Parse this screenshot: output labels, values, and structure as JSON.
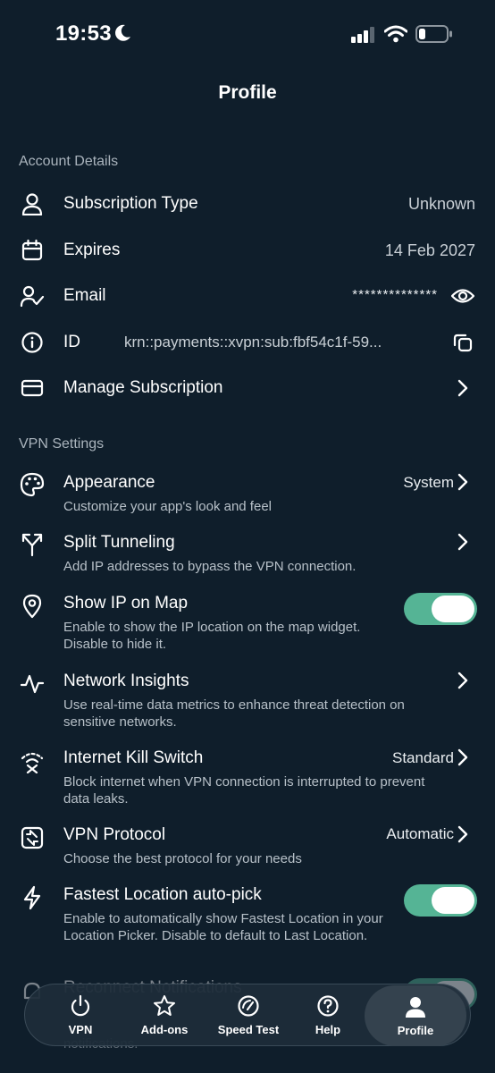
{
  "status": {
    "time": "19:53"
  },
  "header": {
    "title": "Profile"
  },
  "account": {
    "heading": "Account Details",
    "subscription_label": "Subscription Type",
    "subscription_value": "Unknown",
    "expires_label": "Expires",
    "expires_value": "14 Feb 2027",
    "email_label": "Email",
    "email_value": "**************",
    "id_label": "ID",
    "id_value": "krn::payments::xvpn:sub:fbf54c1f-59...",
    "manage_label": "Manage Subscription"
  },
  "vpn": {
    "heading": "VPN Settings",
    "appearance": {
      "title": "Appearance",
      "sub": "Customize your app's look and feel",
      "value": "System"
    },
    "split": {
      "title": "Split Tunneling",
      "sub": "Add IP addresses to bypass the VPN connection."
    },
    "showip": {
      "title": "Show IP on Map",
      "sub": "Enable to show the IP location on the map widget. Disable to hide it.",
      "enabled": true
    },
    "insights": {
      "title": "Network Insights",
      "sub": "Use real-time data metrics to enhance threat detection on sensitive networks."
    },
    "killswitch": {
      "title": "Internet Kill Switch",
      "sub": "Block internet when VPN connection is interrupted to prevent data leaks.",
      "value": "Standard"
    },
    "protocol": {
      "title": "VPN Protocol",
      "sub": "Choose the best protocol for your needs",
      "value": "Automatic"
    },
    "fastest": {
      "title": "Fastest Location auto-pick",
      "sub": "Enable to automatically show Fastest Location in your Location Picker. Disable to default to Last Location.",
      "enabled": true
    },
    "reconnect": {
      "title": "Reconnect Notifications",
      "sub": "notifications."
    }
  },
  "nav": {
    "vpn": "VPN",
    "addons": "Add-ons",
    "speed": "Speed Test",
    "help": "Help",
    "profile": "Profile",
    "active": "profile"
  },
  "colors": {
    "background": "#0f1e2b",
    "accent": "#55b495"
  }
}
